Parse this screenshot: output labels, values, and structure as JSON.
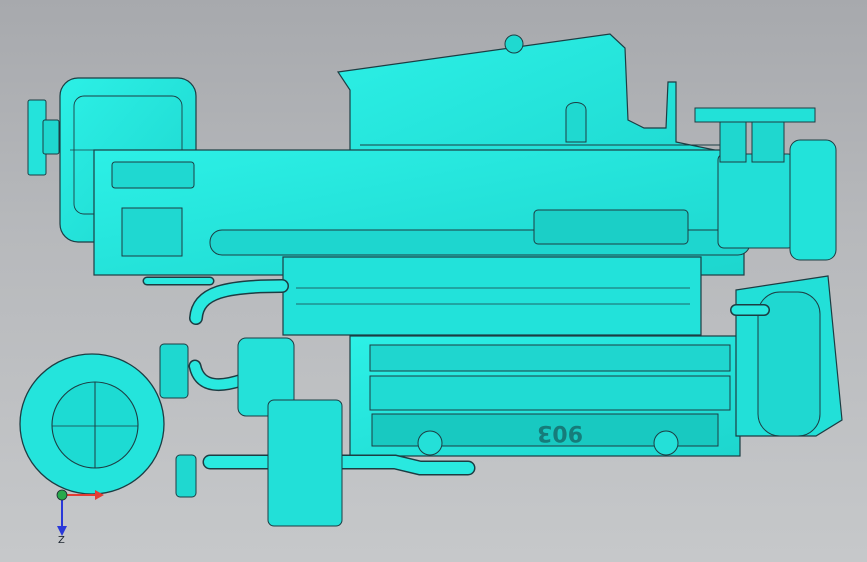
{
  "viewport": {
    "background_top": "#a7a9ad",
    "background_bottom": "#c6c8ca",
    "model_color": "#27e7de",
    "model_shadow": "#16bfb8",
    "edge_color": "#1c3d43"
  },
  "model": {
    "block_marking": "903"
  },
  "triad": {
    "x_color": "#e33c33",
    "y_color": "#29a94c",
    "z_color": "#2938d9",
    "z_label": "Z"
  }
}
